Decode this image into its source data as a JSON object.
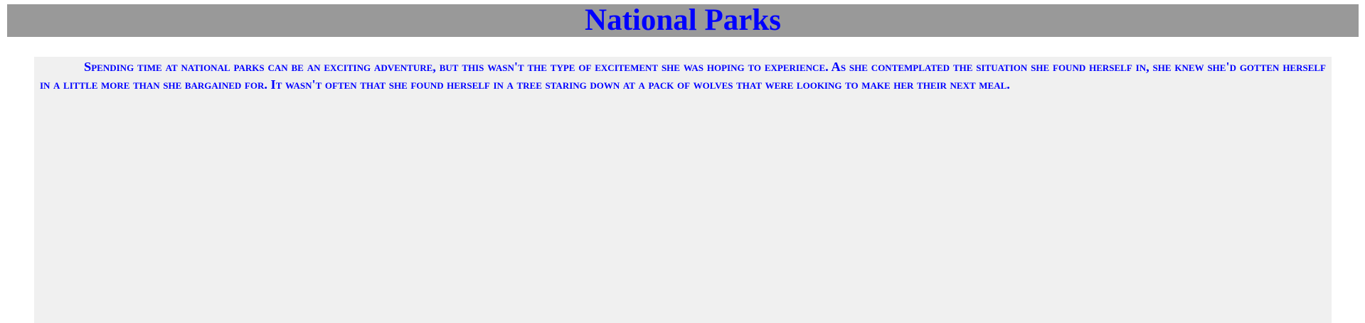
{
  "header": {
    "title": "National Parks"
  },
  "main": {
    "paragraph": "Spending time at national parks can be an exciting adventure, but this wasn't the type of excitement she was hoping to experience. As she contemplated the situation she found herself in, she knew she'd gotten herself in a little more than she bargained for. It wasn't often that she found herself in a tree staring down at a pack of wolves that were looking to make her their next meal."
  },
  "colors": {
    "header_background": "#999999",
    "text": "#0000ff",
    "panel_background": "#f0f0f0",
    "page_background": "#ffffff"
  }
}
